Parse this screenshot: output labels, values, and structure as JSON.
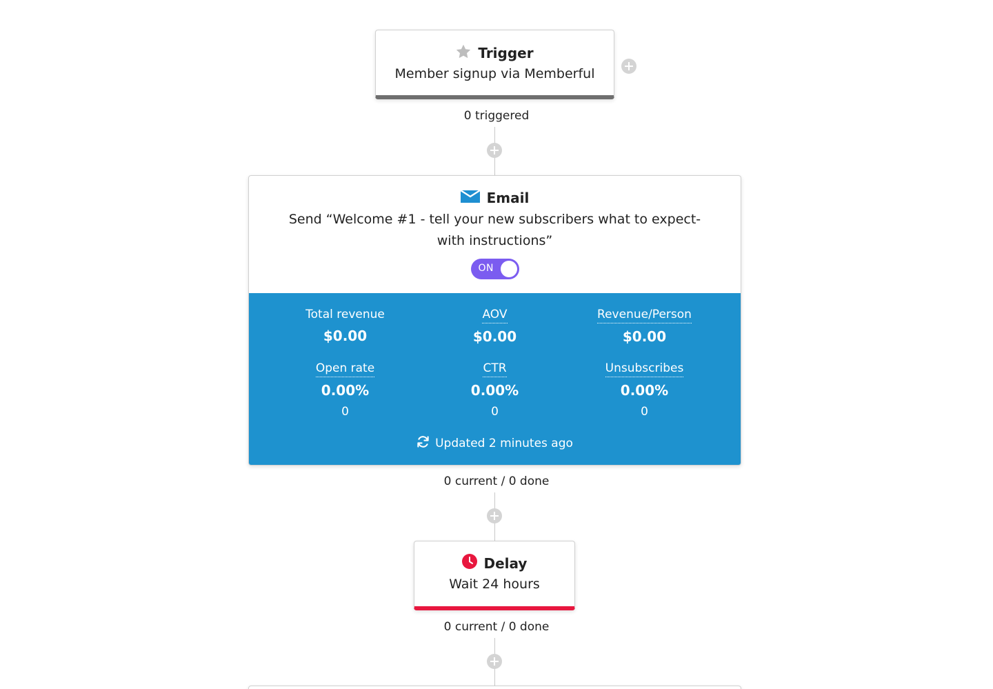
{
  "trigger": {
    "title": "Trigger",
    "description": "Member signup via Memberful",
    "icon": "star-icon",
    "stat": "0 triggered",
    "accent": "#6f6f6f"
  },
  "email": {
    "title": "Email",
    "icon": "envelope-icon",
    "description": "Send “Welcome #1 - tell your new subscribers what to expect- with instructions”",
    "toggle_label": "ON",
    "toggle_color": "#7b5cf0",
    "stats_bg": "#1e92cf",
    "stats": [
      {
        "label": "Total revenue",
        "value": "$0.00",
        "count": ""
      },
      {
        "label": "AOV",
        "value": "$0.00",
        "count": ""
      },
      {
        "label": "Revenue/Person",
        "value": "$0.00",
        "count": ""
      },
      {
        "label": "Open rate",
        "value": "0.00%",
        "count": "0"
      },
      {
        "label": "CTR",
        "value": "0.00%",
        "count": "0"
      },
      {
        "label": "Unsubscribes",
        "value": "0.00%",
        "count": "0"
      }
    ],
    "updated": "Updated 2 minutes ago",
    "progress": "0 current / 0 done"
  },
  "delay": {
    "title": "Delay",
    "icon": "clock-icon",
    "description": "Wait 24 hours",
    "progress": "0 current / 0 done",
    "accent": "#e8173e"
  }
}
